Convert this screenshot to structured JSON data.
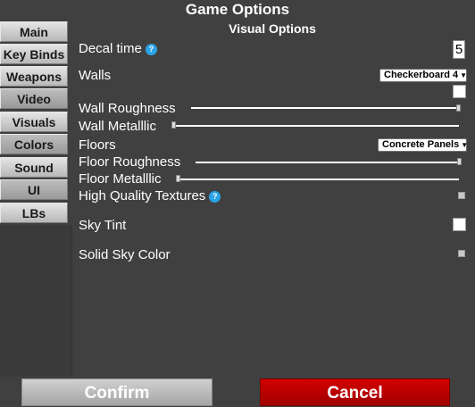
{
  "window": {
    "title": "Game Options"
  },
  "sidebar": {
    "tabs": [
      {
        "label": "Main"
      },
      {
        "label": "Key Binds"
      },
      {
        "label": "Weapons"
      },
      {
        "label": "Video"
      },
      {
        "label": "Visuals"
      },
      {
        "label": "Colors"
      },
      {
        "label": "Sound"
      },
      {
        "label": "UI"
      },
      {
        "label": "LBs"
      }
    ]
  },
  "panel": {
    "title": "Visual Options",
    "decal_time": {
      "label": "Decal time",
      "value": "5",
      "help_icon": "?"
    },
    "walls": {
      "label": "Walls",
      "selected": "Checkerboard 4"
    },
    "wall_roughness": {
      "label": "Wall Roughness",
      "value": 1.0
    },
    "wall_metallic": {
      "label": "Wall Metalllic",
      "value": 0.0
    },
    "floors": {
      "label": "Floors",
      "selected": "Concrete Panels"
    },
    "floor_roughness": {
      "label": "Floor Roughness",
      "value": 1.0
    },
    "floor_metallic": {
      "label": "Floor Metalllic",
      "value": 0.0
    },
    "hq_textures": {
      "label": "High Quality Textures",
      "checked": false,
      "help_icon": "?"
    },
    "sky_tint": {
      "label": "Sky Tint",
      "checked": false
    },
    "solid_sky_color": {
      "label": "Solid Sky Color",
      "checked": false
    }
  },
  "footer": {
    "confirm_label": "Confirm",
    "cancel_label": "Cancel"
  },
  "colors": {
    "background": "#404040",
    "tab": "#c8c8c8",
    "cancel": "#c00000",
    "confirm": "#b4b4b4",
    "help": "#2aa3e6"
  }
}
